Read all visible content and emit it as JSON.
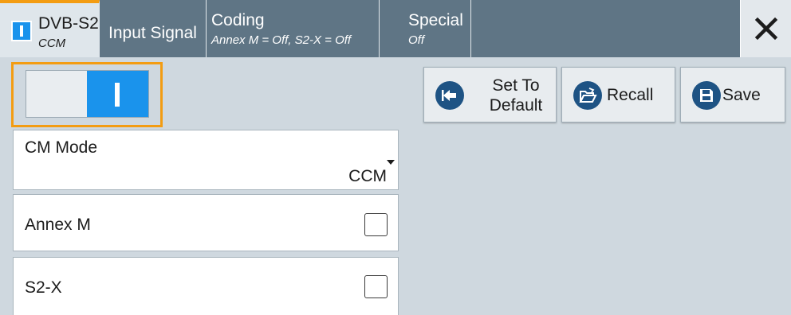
{
  "tabs": [
    {
      "title": "DVB-S2",
      "subtitle": "CCM",
      "active": true
    },
    {
      "title": "Input Signal",
      "subtitle": ""
    },
    {
      "title": "Coding",
      "subtitle": "Annex M = Off, S2-X = Off"
    },
    {
      "title": "Special",
      "subtitle": "Off"
    }
  ],
  "state": {
    "on": true
  },
  "buttons": {
    "set_default": "Set To Default",
    "set_default_line1": "Set To",
    "set_default_line2": "Default",
    "recall": "Recall",
    "save": "Save"
  },
  "fields": {
    "cm_mode": {
      "label": "CM Mode",
      "value": "CCM"
    },
    "annex_m": {
      "label": "Annex M",
      "checked": false
    },
    "s2x": {
      "label": "S2-X",
      "checked": false
    }
  },
  "colors": {
    "accent_orange": "#f39c12",
    "tab_bar": "#5f7585",
    "toggle_on_blue": "#1a93ec",
    "button_icon_navy": "#1e5384",
    "background": "#cfd8df"
  },
  "icons": {
    "close": "close-icon",
    "set_default": "set-default-icon",
    "recall": "folder-open-icon",
    "save": "floppy-disk-icon",
    "dropdown": "dropdown-arrow-icon",
    "state_indicator": "state-on-icon"
  }
}
